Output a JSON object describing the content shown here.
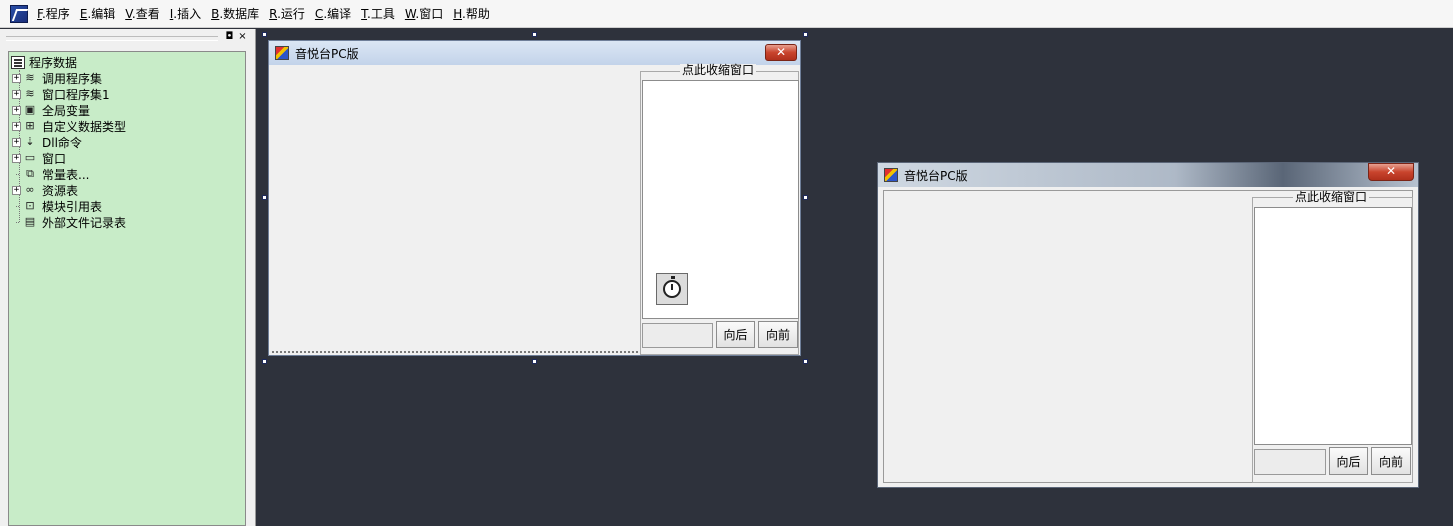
{
  "menu": [
    {
      "acc": "F",
      "label": ".程序"
    },
    {
      "acc": "E",
      "label": ".编辑"
    },
    {
      "acc": "V",
      "label": ".查看"
    },
    {
      "acc": "I",
      "label": ".插入"
    },
    {
      "acc": "B",
      "label": ".数据库"
    },
    {
      "acc": "R",
      "label": ".运行"
    },
    {
      "acc": "C",
      "label": ".编译"
    },
    {
      "acc": "T",
      "label": ".工具"
    },
    {
      "acc": "W",
      "label": ".窗口"
    },
    {
      "acc": "H",
      "label": ".帮助"
    }
  ],
  "dock": {
    "restore_glyph": "◘",
    "close_glyph": "×"
  },
  "tree": {
    "root": "程序数据",
    "items": [
      {
        "label": "调用程序集",
        "icon": "stack-icon",
        "glyph": "≋",
        "expandable": true
      },
      {
        "label": "窗口程序集1",
        "icon": "stack-icon",
        "glyph": "≋",
        "expandable": true
      },
      {
        "label": "全局变量",
        "icon": "variable-icon",
        "glyph": "▣",
        "expandable": true
      },
      {
        "label": "自定义数据类型",
        "icon": "data-type-icon",
        "glyph": "⊞",
        "expandable": true
      },
      {
        "label": "Dll命令",
        "icon": "dll-icon",
        "glyph": "⇣",
        "expandable": true
      },
      {
        "label": "窗口",
        "icon": "window-icon",
        "glyph": "▭",
        "expandable": true
      },
      {
        "label": "常量表...",
        "icon": "constant-icon",
        "glyph": "⧉",
        "expandable": false
      },
      {
        "label": "资源表",
        "icon": "resource-icon",
        "glyph": "∞",
        "expandable": true
      },
      {
        "label": "模块引用表",
        "icon": "module-icon",
        "glyph": "⊡",
        "expandable": false
      },
      {
        "label": "外部文件记录表",
        "icon": "file-icon",
        "glyph": "▤",
        "expandable": false
      }
    ]
  },
  "design_window": {
    "title": "音悦台PC版",
    "close_glyph": "✕",
    "panel_label": "点此收缩窗口",
    "back_label": "向后",
    "forward_label": "向前",
    "edit_value": ""
  },
  "preview_window": {
    "title": "音悦台PC版",
    "close_glyph": "✕",
    "panel_label": "点此收缩窗口",
    "back_label": "向后",
    "forward_label": "向前",
    "edit_value": ""
  }
}
